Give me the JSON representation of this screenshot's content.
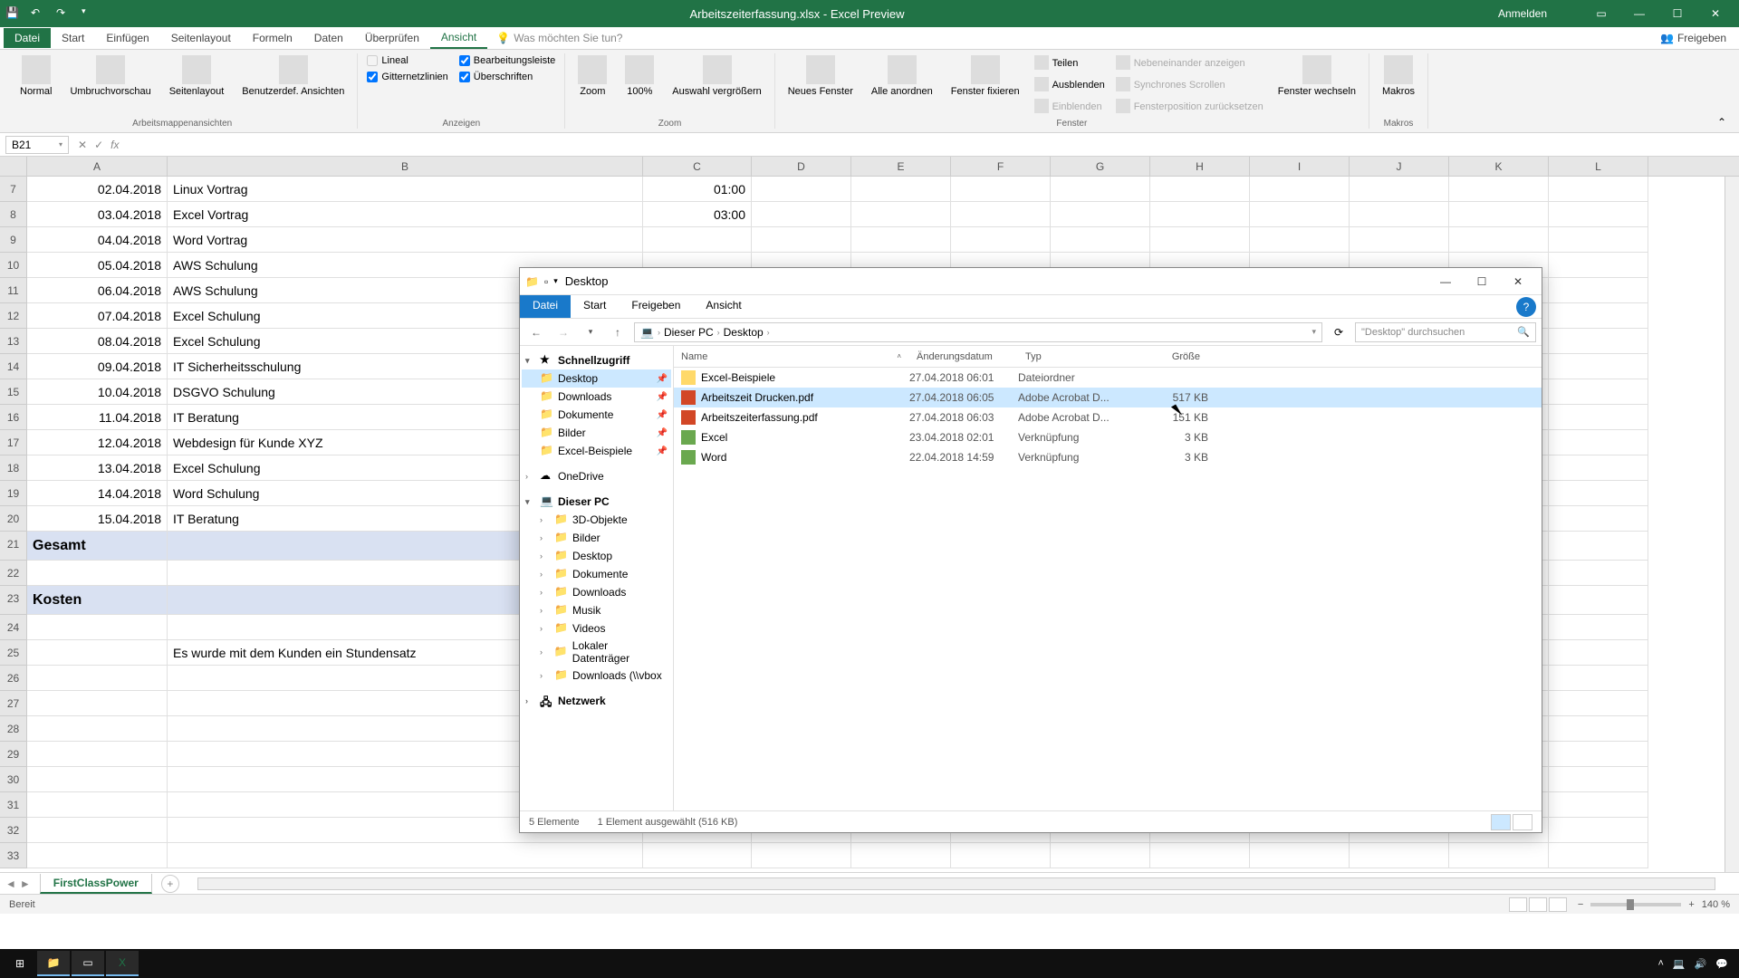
{
  "excel": {
    "title": "Arbeitszeiterfassung.xlsx - Excel Preview",
    "signin": "Anmelden",
    "tabs": {
      "file": "Datei",
      "start": "Start",
      "insert": "Einfügen",
      "pagelayout": "Seitenlayout",
      "formulas": "Formeln",
      "data": "Daten",
      "review": "Überprüfen",
      "view": "Ansicht"
    },
    "tellme": "Was möchten Sie tun?",
    "share": "Freigeben",
    "ribbon": {
      "views": {
        "normal": "Normal",
        "pagebreak": "Umbruchvorschau",
        "pagelayout": "Seitenlayout",
        "custom": "Benutzerdef. Ansichten",
        "group": "Arbeitsmappenansichten"
      },
      "show": {
        "ruler": "Lineal",
        "gridlines": "Gitternetzlinien",
        "formulabar": "Bearbeitungsleiste",
        "headings": "Überschriften",
        "group": "Anzeigen"
      },
      "zoom": {
        "zoom": "Zoom",
        "hundred": "100%",
        "selection": "Auswahl vergrößern",
        "group": "Zoom"
      },
      "window": {
        "new": "Neues Fenster",
        "all": "Alle anordnen",
        "freeze": "Fenster fixieren",
        "split": "Teilen",
        "hide": "Ausblenden",
        "unhide": "Einblenden",
        "side": "Nebeneinander anzeigen",
        "sync": "Synchrones Scrollen",
        "reset": "Fensterposition zurücksetzen",
        "switch": "Fenster wechseln",
        "group": "Fenster"
      },
      "macros": {
        "macros": "Makros",
        "group": "Makros"
      }
    },
    "namebox": "B21",
    "columns": [
      "A",
      "B",
      "C",
      "D",
      "E",
      "F",
      "G",
      "H",
      "I",
      "J",
      "K",
      "L"
    ],
    "rows": [
      {
        "n": 7,
        "a": "02.04.2018",
        "b": "Linux Vortrag",
        "c": "01:00"
      },
      {
        "n": 8,
        "a": "03.04.2018",
        "b": "Excel Vortrag",
        "c": "03:00"
      },
      {
        "n": 9,
        "a": "04.04.2018",
        "b": "Word Vortrag",
        "c": ""
      },
      {
        "n": 10,
        "a": "05.04.2018",
        "b": "AWS Schulung",
        "c": ""
      },
      {
        "n": 11,
        "a": "06.04.2018",
        "b": "AWS Schulung",
        "c": ""
      },
      {
        "n": 12,
        "a": "07.04.2018",
        "b": "Excel Schulung",
        "c": ""
      },
      {
        "n": 13,
        "a": "08.04.2018",
        "b": "Excel Schulung",
        "c": ""
      },
      {
        "n": 14,
        "a": "09.04.2018",
        "b": "IT Sicherheitsschulung",
        "c": ""
      },
      {
        "n": 15,
        "a": "10.04.2018",
        "b": "DSGVO Schulung",
        "c": ""
      },
      {
        "n": 16,
        "a": "11.04.2018",
        "b": "IT Beratung",
        "c": ""
      },
      {
        "n": 17,
        "a": "12.04.2018",
        "b": "Webdesign für Kunde XYZ",
        "c": ""
      },
      {
        "n": 18,
        "a": "13.04.2018",
        "b": "Excel Schulung",
        "c": ""
      },
      {
        "n": 19,
        "a": "14.04.2018",
        "b": "Word Schulung",
        "c": ""
      },
      {
        "n": 20,
        "a": "15.04.2018",
        "b": "IT Beratung",
        "c": ""
      }
    ],
    "gesamt_row": 21,
    "gesamt": "Gesamt",
    "kosten_row": 23,
    "kosten": "Kosten",
    "note_row": 25,
    "note": "Es wurde mit dem Kunden ein Stundensatz",
    "empty_rows": [
      22,
      24,
      26,
      27,
      28,
      29,
      30,
      31,
      32,
      33
    ],
    "sheet_tab": "FirstClassPower",
    "status": "Bereit",
    "zoom": "140 %"
  },
  "explorer": {
    "title": "Desktop",
    "tabs": {
      "file": "Datei",
      "start": "Start",
      "share": "Freigeben",
      "view": "Ansicht"
    },
    "breadcrumb": {
      "pc": "Dieser PC",
      "desktop": "Desktop"
    },
    "search_placeholder": "\"Desktop\" durchsuchen",
    "nav": {
      "quick": "Schnellzugriff",
      "quick_items": [
        {
          "label": "Desktop",
          "selected": true
        },
        {
          "label": "Downloads"
        },
        {
          "label": "Dokumente"
        },
        {
          "label": "Bilder"
        },
        {
          "label": "Excel-Beispiele"
        }
      ],
      "onedrive": "OneDrive",
      "thispc": "Dieser PC",
      "pc_items": [
        {
          "label": "3D-Objekte"
        },
        {
          "label": "Bilder"
        },
        {
          "label": "Desktop"
        },
        {
          "label": "Dokumente"
        },
        {
          "label": "Downloads"
        },
        {
          "label": "Musik"
        },
        {
          "label": "Videos"
        },
        {
          "label": "Lokaler Datenträger"
        },
        {
          "label": "Downloads (\\\\vbox"
        }
      ],
      "network": "Netzwerk"
    },
    "headers": {
      "name": "Name",
      "date": "Änderungsdatum",
      "type": "Typ",
      "size": "Größe"
    },
    "files": [
      {
        "name": "Excel-Beispiele",
        "date": "27.04.2018 06:01",
        "type": "Dateiordner",
        "size": "",
        "icon": "folder",
        "selected": false
      },
      {
        "name": "Arbeitszeit Drucken.pdf",
        "date": "27.04.2018 06:05",
        "type": "Adobe Acrobat D...",
        "size": "517 KB",
        "icon": "pdf",
        "selected": true
      },
      {
        "name": "Arbeitszeiterfassung.pdf",
        "date": "27.04.2018 06:03",
        "type": "Adobe Acrobat D...",
        "size": "151 KB",
        "icon": "pdf",
        "selected": false
      },
      {
        "name": "Excel",
        "date": "23.04.2018 02:01",
        "type": "Verknüpfung",
        "size": "3 KB",
        "icon": "lnk",
        "selected": false
      },
      {
        "name": "Word",
        "date": "22.04.2018 14:59",
        "type": "Verknüpfung",
        "size": "3 KB",
        "icon": "lnk",
        "selected": false
      }
    ],
    "status_count": "5 Elemente",
    "status_sel": "1 Element ausgewählt (516 KB)"
  }
}
